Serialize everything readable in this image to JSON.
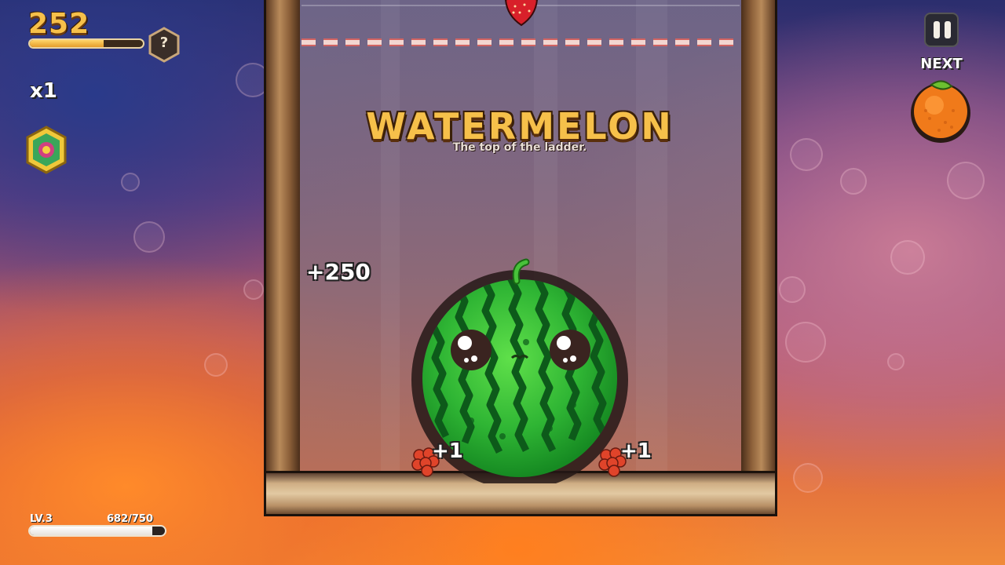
{
  "hud": {
    "score": "252",
    "score_progress": 0.65,
    "help_label": "?",
    "multiplier": "x1",
    "level_label": "LV.3",
    "xp_text": "682/750",
    "xp_progress": 0.909,
    "next_label": "NEXT"
  },
  "announcement": {
    "title": "WATERMELON",
    "subtitle": "The top of the ladder."
  },
  "popups": {
    "points_main": "+250",
    "points_left": "+1",
    "points_right": "+1"
  },
  "pieces": {
    "dropping": "strawberry",
    "merged": "watermelon",
    "next": "orange",
    "bonus": [
      "raspberry",
      "raspberry"
    ]
  },
  "colors": {
    "score_gold": "#f6c04a",
    "watermelon_green": "#2fb534",
    "orange": "#f07a1a"
  }
}
